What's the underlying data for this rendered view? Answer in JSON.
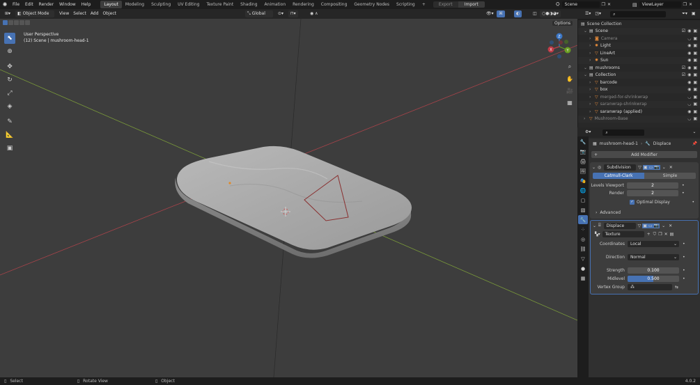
{
  "menus": [
    "File",
    "Edit",
    "Render",
    "Window",
    "Help"
  ],
  "workspaces": [
    "Layout",
    "Modeling",
    "Sculpting",
    "UV Editing",
    "Texture Paint",
    "Shading",
    "Animation",
    "Rendering",
    "Compositing",
    "Geometry Nodes",
    "Scripting"
  ],
  "active_workspace": "Layout",
  "top_right": {
    "export": "Export",
    "import": "Import",
    "scene": "Scene",
    "view_layer": "ViewLayer"
  },
  "viewport_header": {
    "mode": "Object Mode",
    "menus": [
      "View",
      "Select",
      "Add",
      "Object"
    ],
    "transform": "Global",
    "options": "Options"
  },
  "viewport_overlay": {
    "line1": "User Perspective",
    "line2": "(12) Scene | mushroom-head-1"
  },
  "gizmo": {
    "z": "Z",
    "y": "Y",
    "x": "X"
  },
  "outliner": {
    "title": "Scene Collection",
    "rows": [
      {
        "label": "Scene",
        "color": "#d8d8d8",
        "icon": "collection-icon"
      },
      {
        "label": "Camera",
        "color": "#8a8a8a",
        "icon": "camera-icon"
      },
      {
        "label": "Light",
        "color": "#d8d8d8",
        "icon": "light-icon"
      },
      {
        "label": "LineArt",
        "color": "#d8d8d8",
        "icon": "lineart-icon"
      },
      {
        "label": "Sun",
        "color": "#d8d8d8",
        "icon": "sun-icon"
      },
      {
        "label": "mushrooms",
        "color": "#d8d8d8",
        "icon": "collection-icon"
      },
      {
        "label": "Collection",
        "color": "#d8d8d8",
        "icon": "collection-icon"
      },
      {
        "label": "barcode",
        "color": "#d8d8d8",
        "icon": "mesh-icon"
      },
      {
        "label": "box",
        "color": "#d8d8d8",
        "icon": "mesh-icon"
      },
      {
        "label": "merged-for-shrinkwrap",
        "color": "#8a8a8a",
        "icon": "mesh-icon"
      },
      {
        "label": "saranwrap-shrinkwrap",
        "color": "#8a8a8a",
        "icon": "mesh-icon"
      },
      {
        "label": "saranwrap (applied)",
        "color": "#d8d8d8",
        "icon": "mesh-icon"
      },
      {
        "label": "Mushroom-Base",
        "color": "#8a8a8a",
        "icon": "mesh-icon"
      }
    ]
  },
  "properties": {
    "breadcrumb_object": "mushroom-head-1",
    "breadcrumb_modifier": "Displace",
    "add_modifier": "Add Modifier",
    "subdivision": {
      "name": "Subdivision",
      "type_options": [
        "Catmull-Clark",
        "Simple"
      ],
      "active_type": "Catmull-Clark",
      "levels_viewport_label": "Levels Viewport",
      "levels_viewport": "2",
      "render_label": "Render",
      "render": "2",
      "optimal_display": "Optimal Display",
      "advanced": "Advanced"
    },
    "displace": {
      "name": "Displace",
      "texture": "Texture",
      "coordinates_label": "Coordinates",
      "coordinates": "Local",
      "direction_label": "Direction",
      "direction": "Normal",
      "strength_label": "Strength",
      "strength": "0.100",
      "midlevel_label": "Midlevel",
      "midlevel": "0.500",
      "midlevel_fraction": 0.5,
      "vertex_group_label": "Vertex Group"
    }
  },
  "status": {
    "select": "Select",
    "rotate": "Rotate View",
    "object": "Object",
    "version": "4.0.2"
  }
}
